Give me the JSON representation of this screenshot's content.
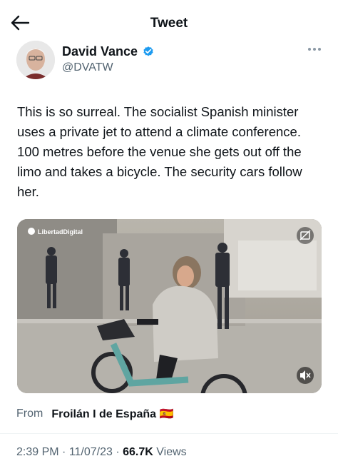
{
  "header": {
    "title": "Tweet"
  },
  "author": {
    "name": "David Vance",
    "handle": "@DVATW"
  },
  "tweet": {
    "text": "This is so surreal. The socialist Spanish minister uses a private jet to attend a climate conference. 100 metres before the venue she gets out off the limo and takes a bicycle. The security cars follow her."
  },
  "media": {
    "watermark": "LibertadDigital"
  },
  "source": {
    "label": "From",
    "name": "Froilán I de España",
    "flag": "🇪🇸"
  },
  "meta": {
    "time": "2:39 PM",
    "sep1": " · ",
    "date": "11/07/23",
    "sep2": " · ",
    "views": "66.7K",
    "views_label": " Views"
  },
  "icons": [
    "back-arrow-icon",
    "verified-badge-icon",
    "more-icon",
    "sensitive-content-icon",
    "muted-volume-icon"
  ],
  "colors": {
    "verified": "#1d9bf0",
    "secondary": "#536471"
  }
}
